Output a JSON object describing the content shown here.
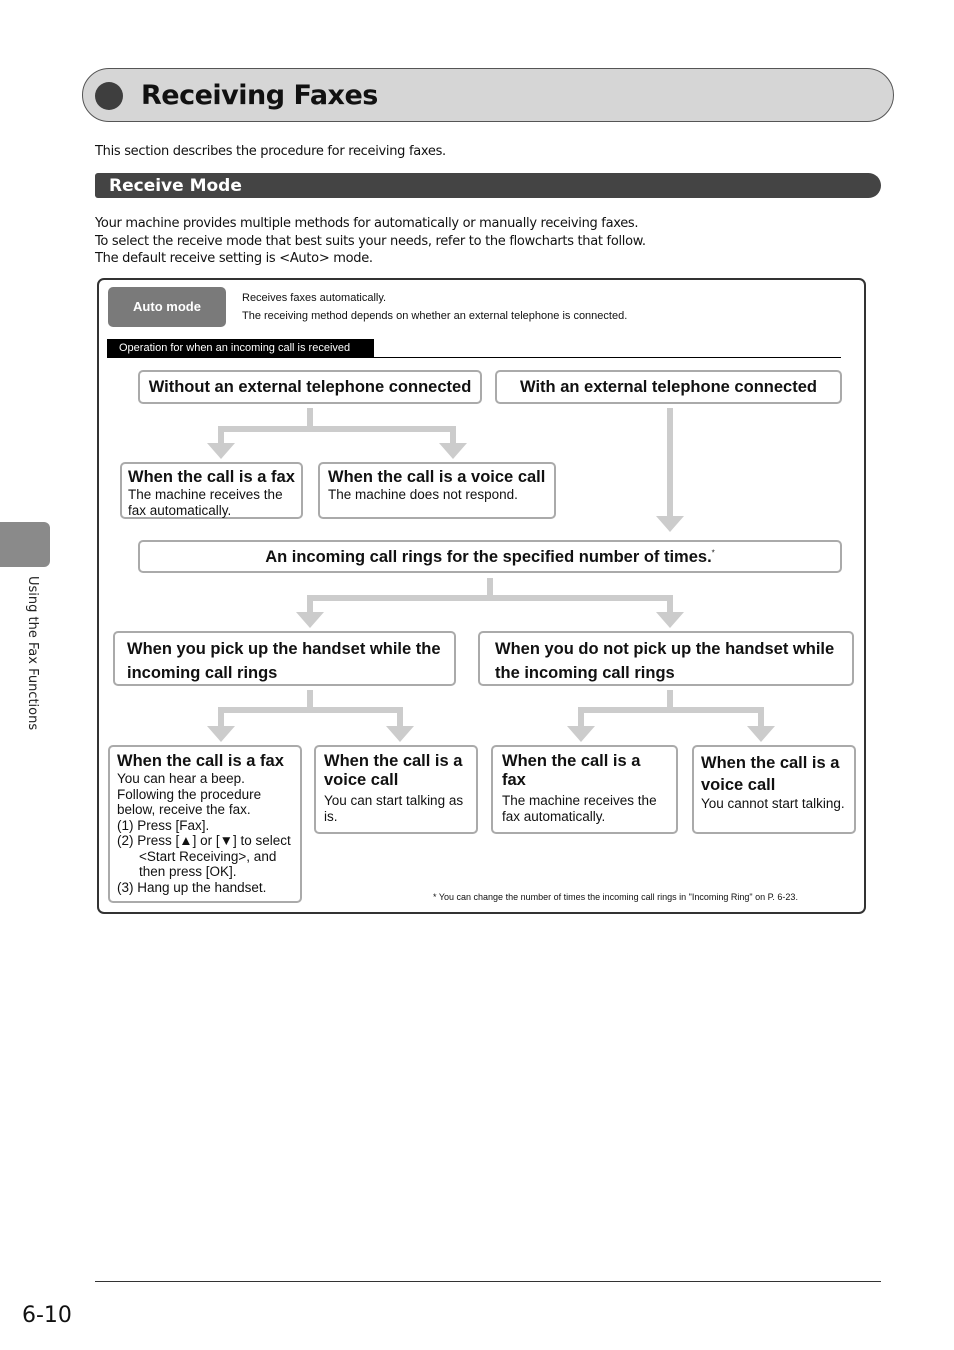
{
  "header": {
    "title": "Receiving Faxes"
  },
  "intro": "This section describes the procedure for receiving faxes.",
  "section": {
    "title": "Receive Mode",
    "paragraphs": [
      "Your machine provides multiple methods for automatically or manually receiving faxes.",
      "To select the receive mode that best suits your needs, refer to the flowcharts that follow.",
      "The default receive setting is <Auto> mode."
    ]
  },
  "mode": {
    "label": "Auto mode",
    "desc1": "Receives faxes automatically.",
    "desc2": "The receiving method depends on whether an external telephone is connected."
  },
  "operation_label": "Operation for when an incoming call is received",
  "flow": {
    "without": "Without an external telephone connected",
    "with": "With an external telephone connected",
    "fax1": {
      "title": "When the call is a fax",
      "body": "The machine receives the fax automatically."
    },
    "voice1": {
      "title": "When the call is a voice call",
      "body": "The machine does not respond."
    },
    "rings": "An incoming call rings for the specified number of times.",
    "rings_mark": "*",
    "pickup": "When you pick up the handset while the incoming call rings",
    "nopickup": "When you do not pick up the handset while the incoming call rings",
    "fax2": {
      "title": "When the call is a fax",
      "lines": [
        "You can hear a beep.",
        "Following the procedure below, receive the fax.",
        "(1) Press [Fax].",
        "(2) Press [▲] or [▼] to select <Start Receiving>, and then press [OK].",
        "(3) Hang up the handset."
      ]
    },
    "voice2": {
      "title": "When the call is a voice call",
      "body": "You can start talking as is."
    },
    "fax3": {
      "title": "When the call is a fax",
      "body": "The machine receives the fax automatically."
    },
    "voice3": {
      "title": "When the call is a voice call",
      "body": "You cannot start talking."
    }
  },
  "footnote": "* You can change the number of times the incoming call rings in \"Incoming Ring\" on P. 6-23.",
  "side_tab": "Using the Fax Functions",
  "page_number": "6-10",
  "colors": {
    "arrow": "#cccccc",
    "box_border": "#aaaaaa",
    "section_bar": "#444444"
  }
}
